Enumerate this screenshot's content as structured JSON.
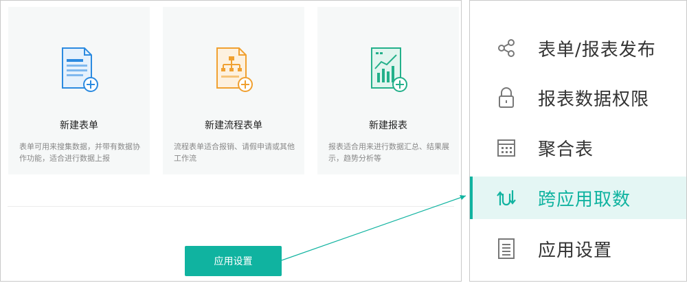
{
  "cards": [
    {
      "title": "新建表单",
      "desc": "表单可用来搜集数据，并带有数据协作功能，适合进行数据上报",
      "icon": "form-add-icon"
    },
    {
      "title": "新建流程表单",
      "desc": "流程表单适合报销、请假申请或其他工作流",
      "icon": "flow-form-add-icon"
    },
    {
      "title": "新建报表",
      "desc": "报表适合用来进行数据汇总、结果展示，趋势分析等",
      "icon": "report-add-icon"
    }
  ],
  "settings_button": "应用设置",
  "menu": [
    {
      "label": "表单/报表发布",
      "icon": "share-icon",
      "active": false
    },
    {
      "label": "报表数据权限",
      "icon": "lock-icon",
      "active": false
    },
    {
      "label": "聚合表",
      "icon": "calendar-grid-icon",
      "active": false
    },
    {
      "label": "跨应用取数",
      "icon": "cross-app-icon",
      "active": true
    },
    {
      "label": "应用设置",
      "icon": "document-icon",
      "active": false
    }
  ],
  "colors": {
    "accent": "#10b3a0",
    "blue": "#2b8ae0",
    "orange": "#f0a030",
    "green": "#23b08a"
  }
}
